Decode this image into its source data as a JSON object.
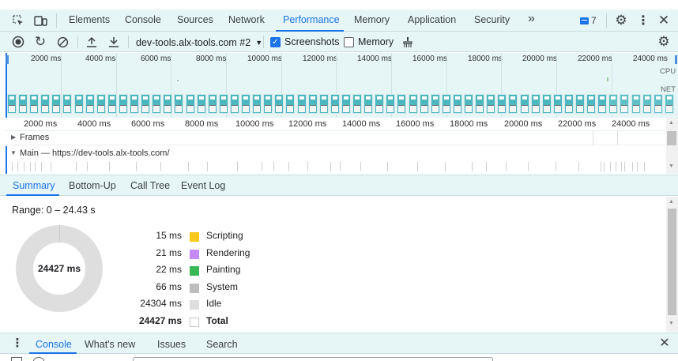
{
  "topbar": {
    "tabs": [
      {
        "label": "Elements"
      },
      {
        "label": "Console"
      },
      {
        "label": "Sources"
      },
      {
        "label": "Network"
      },
      {
        "label": "Performance"
      },
      {
        "label": "Memory"
      },
      {
        "label": "Application"
      },
      {
        "label": "Security"
      }
    ],
    "more_tabs": "»",
    "issues_count": "7"
  },
  "toolbar": {
    "profile_select": "dev-tools.alx-tools.com #2",
    "screenshots_label": "Screenshots",
    "screenshots_checked": true,
    "memory_label": "Memory",
    "memory_checked": false
  },
  "overview": {
    "ticks": [
      "2000 ms",
      "4000 ms",
      "6000 ms",
      "8000 ms",
      "10000 ms",
      "12000 ms",
      "14000 ms",
      "16000 ms",
      "18000 ms",
      "20000 ms",
      "22000 ms",
      "24000 ms"
    ],
    "cpu_label": "CPU",
    "net_label": "NET"
  },
  "flamechart": {
    "ticks": [
      "2000 ms",
      "4000 ms",
      "6000 ms",
      "8000 ms",
      "10000 ms",
      "12000 ms",
      "14000 ms",
      "16000 ms",
      "18000 ms",
      "20000 ms",
      "22000 ms",
      "24000 ms"
    ],
    "frames_label": "Frames",
    "main_label": "Main — https://dev-tools.alx-tools.com/"
  },
  "bottom_tabs": [
    {
      "label": "Summary"
    },
    {
      "label": "Bottom-Up"
    },
    {
      "label": "Call Tree"
    },
    {
      "label": "Event Log"
    }
  ],
  "summary": {
    "range": "Range: 0 – 24.43 s",
    "donut_total": "24427 ms",
    "rows": [
      {
        "value": "15 ms",
        "name": "Scripting",
        "color": "#f9c81c"
      },
      {
        "value": "21 ms",
        "name": "Rendering",
        "color": "#c58af3"
      },
      {
        "value": "22 ms",
        "name": "Painting",
        "color": "#38b755"
      },
      {
        "value": "66 ms",
        "name": "System",
        "color": "#bdbdbd"
      },
      {
        "value": "24304 ms",
        "name": "Idle",
        "color": "#dedede"
      },
      {
        "value": "24427 ms",
        "name": "Total",
        "color": "#ffffff"
      }
    ]
  },
  "drawer": {
    "tabs": [
      {
        "label": "Console"
      },
      {
        "label": "What's new"
      },
      {
        "label": "Issues"
      },
      {
        "label": "Search"
      }
    ]
  }
}
